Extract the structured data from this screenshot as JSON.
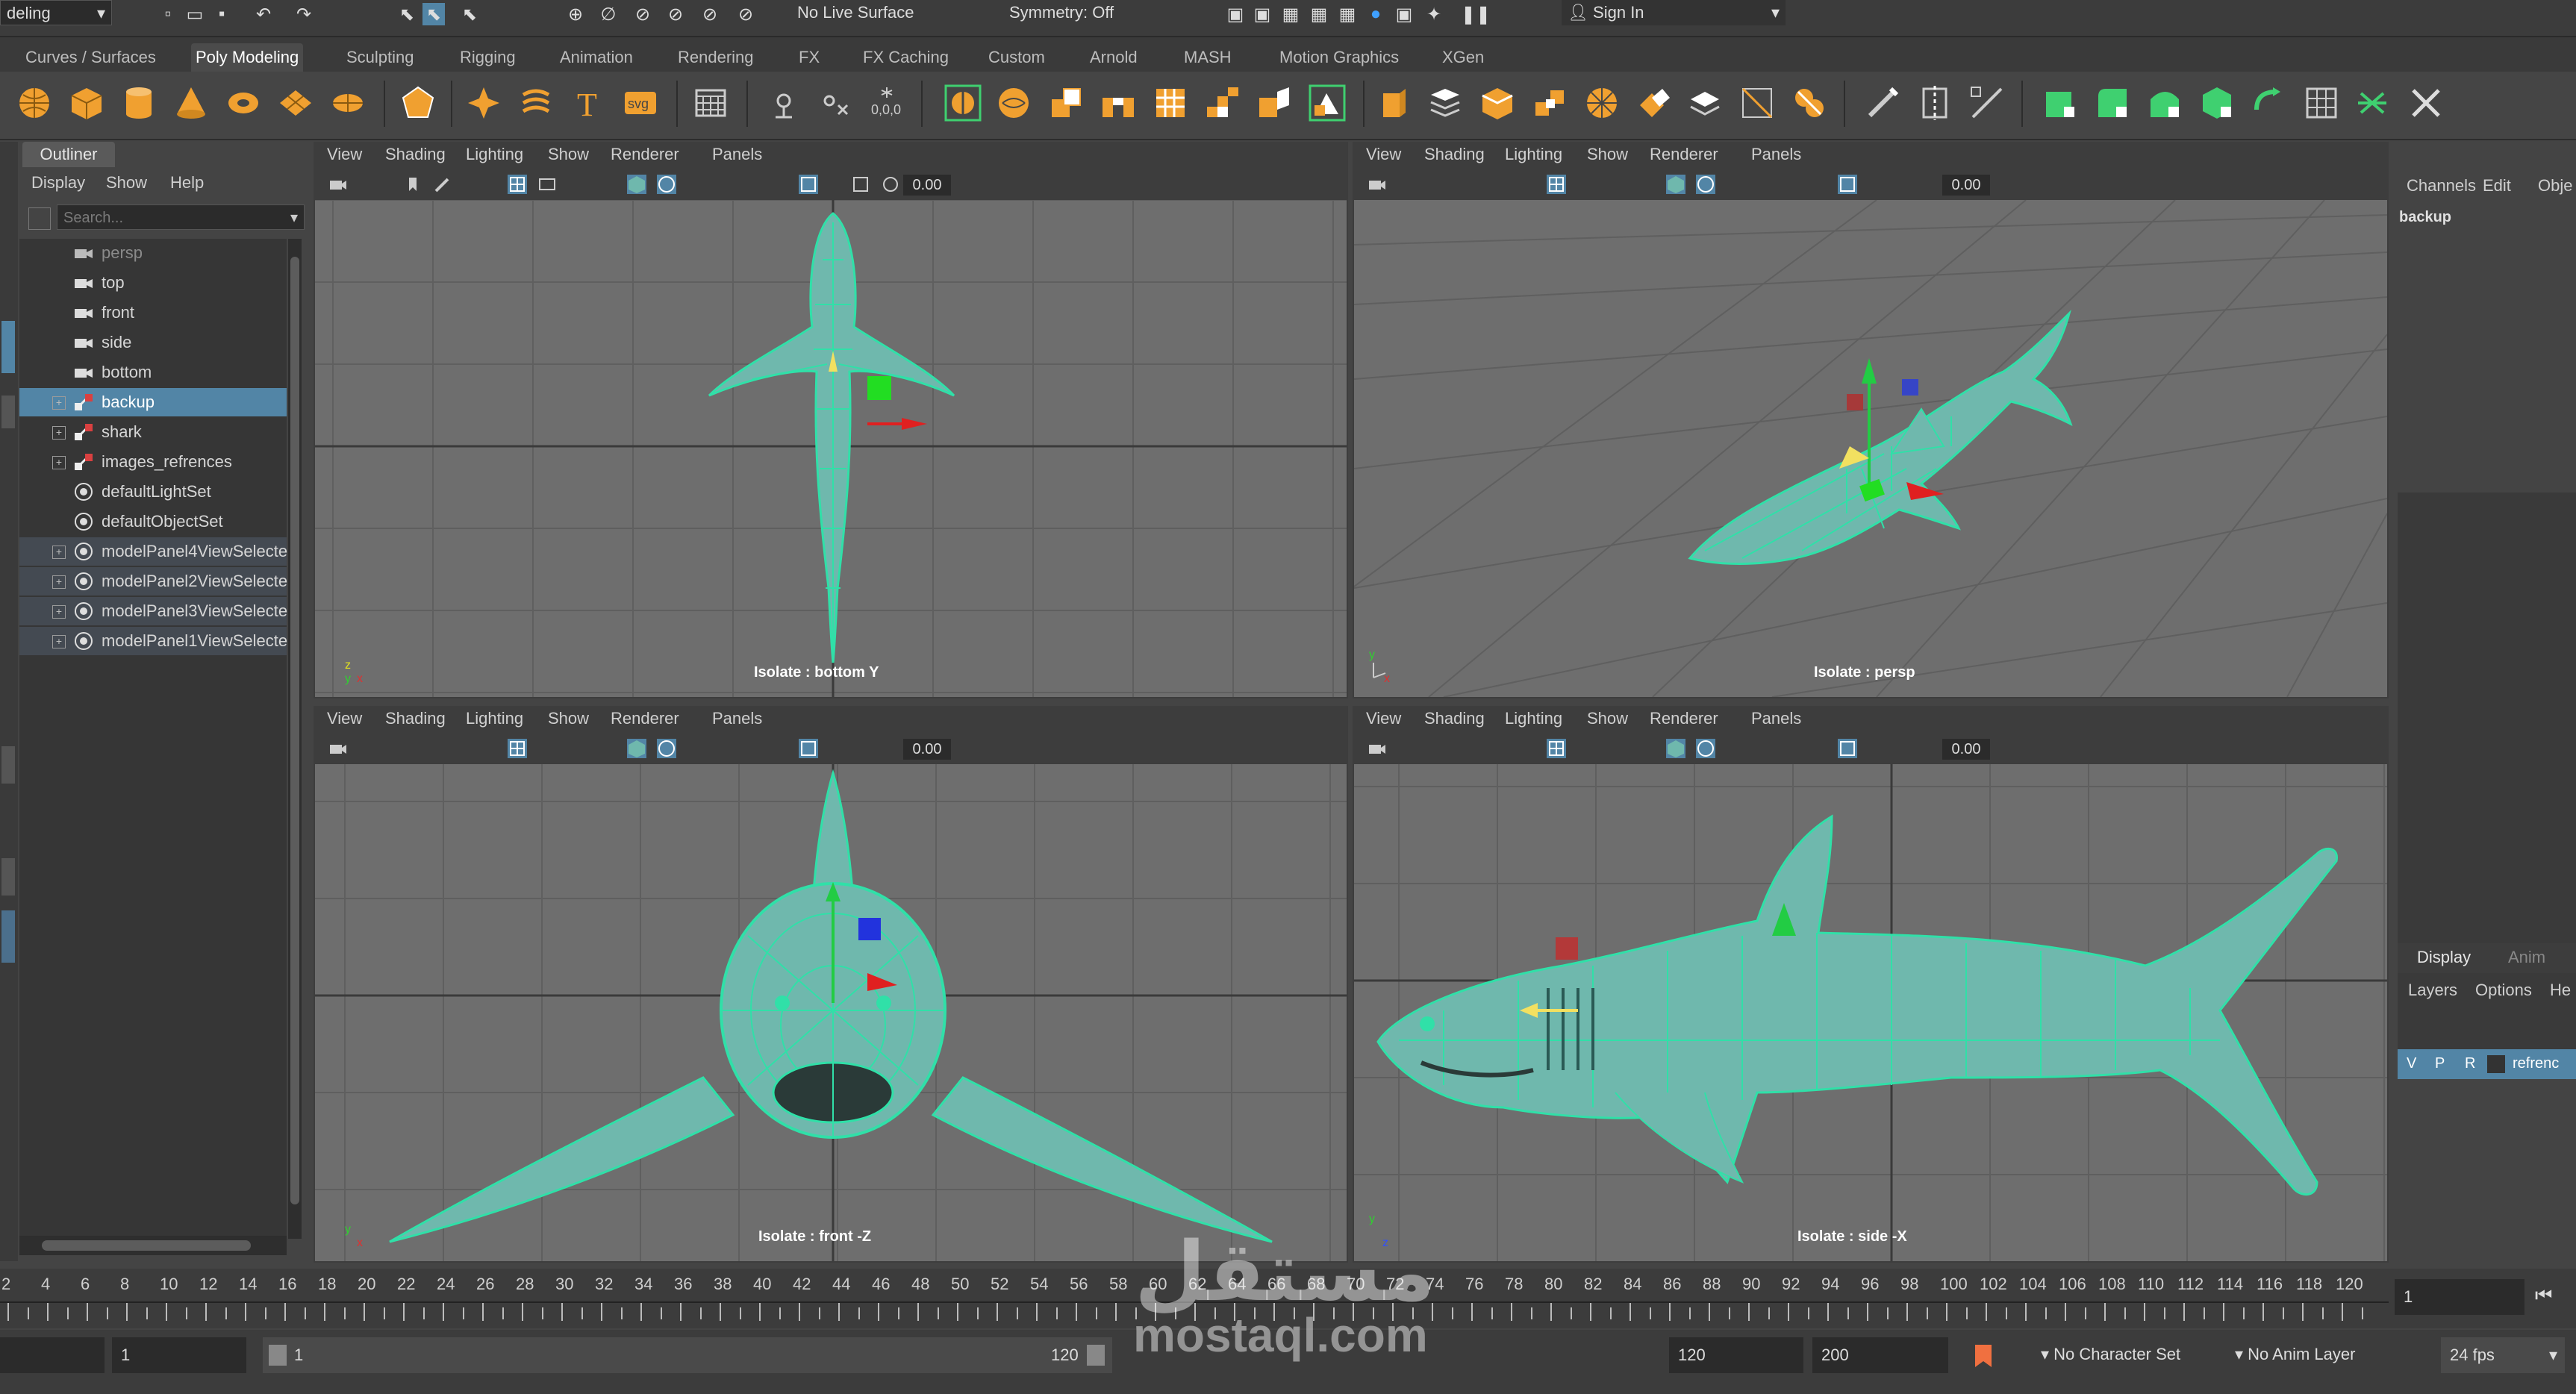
{
  "status_line": {
    "mode_value": "deling",
    "live_surface": "No Live Surface",
    "symmetry": "Symmetry: Off",
    "sign_in": "Sign In"
  },
  "shelf_tabs": [
    "Curves / Surfaces",
    "Poly Modeling",
    "Sculpting",
    "Rigging",
    "Animation",
    "Rendering",
    "FX",
    "FX Caching",
    "Custom",
    "Arnold",
    "MASH",
    "Motion Graphics",
    "XGen"
  ],
  "shelf_active": "Poly Modeling",
  "outliner": {
    "tab": "Outliner",
    "menu": [
      "Display",
      "Show",
      "Help"
    ],
    "search_placeholder": "Search...",
    "items": [
      {
        "label": "persp",
        "type": "camera",
        "dim": true
      },
      {
        "label": "top",
        "type": "camera"
      },
      {
        "label": "front",
        "type": "camera"
      },
      {
        "label": "side",
        "type": "camera"
      },
      {
        "label": "bottom",
        "type": "camera"
      },
      {
        "label": "backup",
        "type": "group",
        "selected": true
      },
      {
        "label": "shark",
        "type": "group"
      },
      {
        "label": "images_refrences",
        "type": "group"
      },
      {
        "label": "defaultLightSet",
        "type": "set"
      },
      {
        "label": "defaultObjectSet",
        "type": "set"
      },
      {
        "label": "modelPanel4ViewSelecte",
        "type": "set",
        "gray": true
      },
      {
        "label": "modelPanel2ViewSelecte",
        "type": "set",
        "gray": true
      },
      {
        "label": "modelPanel3ViewSelecte",
        "type": "set",
        "gray": true
      },
      {
        "label": "modelPanel1ViewSelecte",
        "type": "set",
        "gray": true
      }
    ]
  },
  "viewport_menu": [
    "View",
    "Shading",
    "Lighting",
    "Show",
    "Renderer",
    "Panels"
  ],
  "viewports": [
    {
      "camera_label": "Isolate : bottom Y",
      "field_value": "0.00"
    },
    {
      "camera_label": "Isolate : persp",
      "field_value": "0.00"
    },
    {
      "camera_label": "Isolate : front -Z",
      "field_value": "0.00"
    },
    {
      "camera_label": "Isolate : side -X",
      "field_value": "0.00"
    }
  ],
  "channel_box": {
    "menu": [
      "Channels",
      "Edit",
      "Obje"
    ],
    "object": "backup",
    "layer_tabs": [
      "Display",
      "Anim"
    ],
    "layer_menu": [
      "Layers",
      "Options",
      "He"
    ],
    "layer_flags": [
      "V",
      "P",
      "R"
    ],
    "layer_name": "refrenc"
  },
  "timeline": {
    "ticks": [
      "2",
      "4",
      "6",
      "8",
      "10",
      "12",
      "14",
      "16",
      "18",
      "20",
      "22",
      "24",
      "26",
      "28",
      "30",
      "32",
      "34",
      "36",
      "38",
      "40",
      "42",
      "44",
      "46",
      "48",
      "50",
      "52",
      "54",
      "56",
      "58",
      "60",
      "62",
      "64",
      "66",
      "68",
      "70",
      "72",
      "74",
      "76",
      "78",
      "80",
      "82",
      "84",
      "86",
      "88",
      "90",
      "92",
      "94",
      "96",
      "98",
      "100",
      "102",
      "104",
      "106",
      "108",
      "110",
      "112",
      "114",
      "116",
      "118",
      "120"
    ],
    "current_frame": "1"
  },
  "range": {
    "start": "1",
    "playback_start": "1",
    "playback_end": "120",
    "end": "120",
    "anim_end": "200",
    "character_set": "No Character Set",
    "anim_layer": "No Anim Layer",
    "fps": "24 fps"
  },
  "watermark": {
    "arabic": "مستقل",
    "latin": "mostaql.com"
  },
  "colors": {
    "mesh": "#6fb8ad",
    "wire": "#30e0a8",
    "selection": "#5285a6",
    "shelf_accent": "#f0a030"
  }
}
